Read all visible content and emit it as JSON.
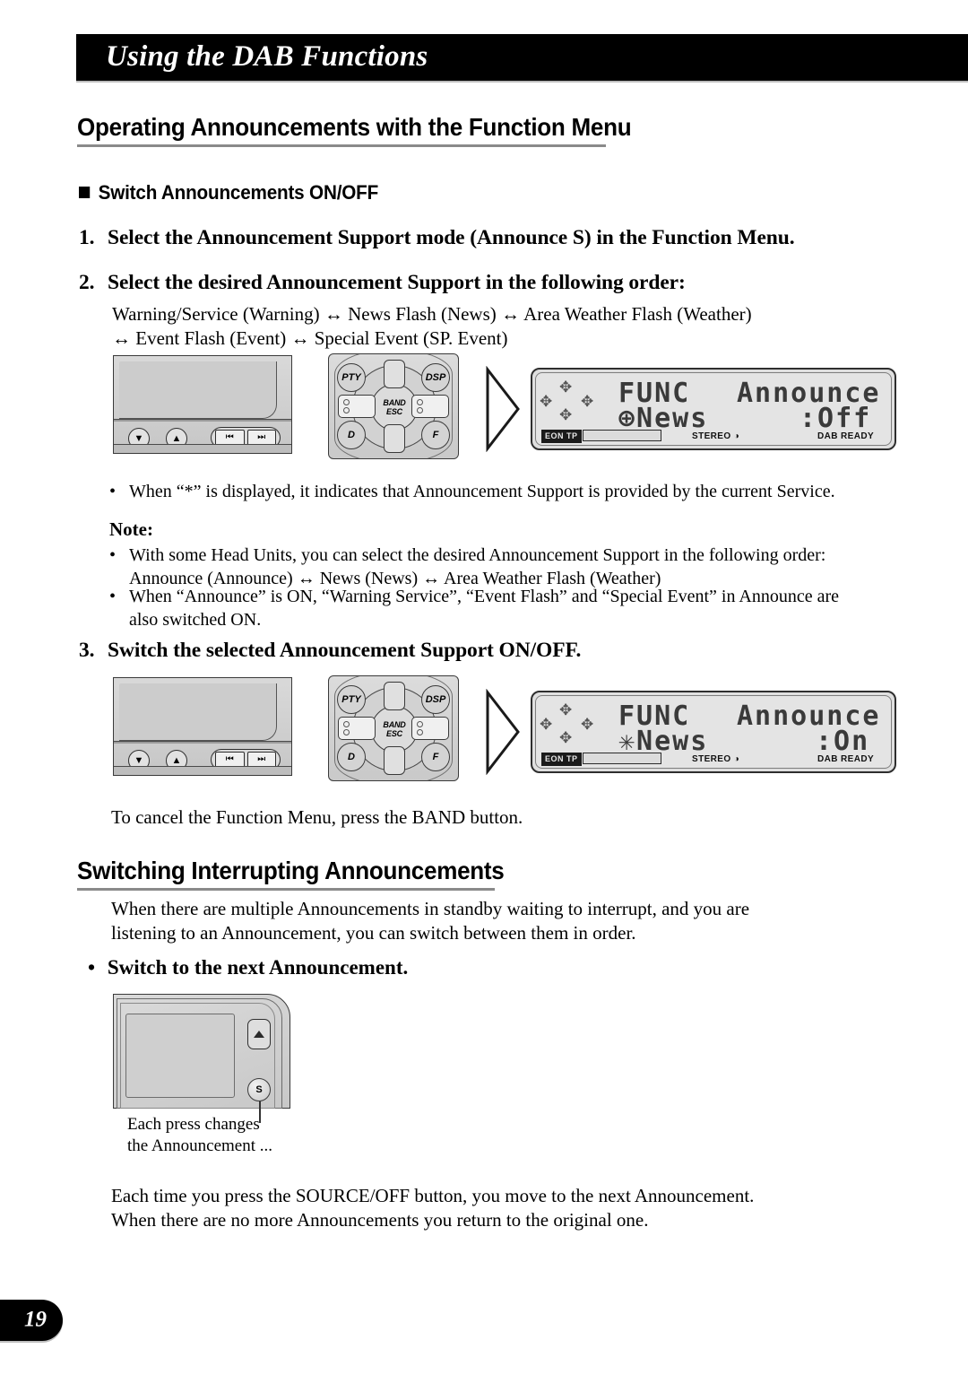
{
  "page": {
    "header_title": "Using the DAB Functions",
    "page_number": "19"
  },
  "section": {
    "heading": "Operating Announcements with the Function Menu",
    "sub_heading": "Switch Announcements ON/OFF"
  },
  "steps": [
    {
      "num": "1.",
      "text": "Select the Announcement Support mode (Announce S) in the Function Menu."
    },
    {
      "num": "2.",
      "text": "Select the desired Announcement Support in the following order:"
    },
    {
      "num": "3.",
      "text": "Switch the selected Announcement Support ON/OFF."
    }
  ],
  "order_lines": {
    "line1": "Warning/Service (Warning) ↔ News Flash (News) ↔ Area Weather Flash (Weather)",
    "line2": "↔ Event Flash (Event) ↔ Special Event (SP. Event)"
  },
  "notes": {
    "asterisk_bullet": "When “*” is displayed, it indicates that Announcement Support is provided by the current Service.",
    "label": "Note:",
    "bullet1_line1": "With some Head Units, you can select the desired Announcement Support in the following order:",
    "bullet1_line2": "Announce (Announce) ↔ News (News) ↔ Area Weather Flash (Weather)",
    "bullet2_line1": "When “Announce” is ON, “Warning Service”, “Event Flash” and “Special Event” in Announce are",
    "bullet2_line2": "also switched ON."
  },
  "cancel_text": "To cancel the Function Menu, press the BAND button.",
  "section2": {
    "heading": "Switching Interrupting Announcements",
    "body_line1": "When there are multiple Announcements in standby waiting to interrupt, and you are",
    "body_line2": "listening to an Announcement, you can switch between them in order.",
    "bullet_heading": "Switch to the next Announcement.",
    "caption_line1": "Each press changes",
    "caption_line2": "the Announcement ...",
    "footer_line1": "Each time you press the SOURCE/OFF button, you move to the next Announcement.",
    "footer_line2": "When there are no more Announcements you return to the original one."
  },
  "head_unit": {
    "down_button": "▼",
    "up_button": "▲",
    "seek_back": "⏮",
    "seek_fwd": "⏭"
  },
  "remote": {
    "pty": "PTY",
    "dsp": "DSP",
    "band": "BAND",
    "esc": "ESC",
    "d": "D",
    "f": "F"
  },
  "lcd_displays": [
    {
      "id": "lcd-off",
      "row1_left": "FUNC",
      "row1_right": "Announce S",
      "row2_left": "⊕News",
      "row2_right": ":Off",
      "eon_tp": "EON  TP",
      "stereo": "STEREO ◑",
      "dab_ready": "DAB READY"
    },
    {
      "id": "lcd-on",
      "row1_left": "FUNC",
      "row1_right": "Announce S",
      "row2_left": "✳News",
      "row2_right": ":On",
      "eon_tp": "EON  TP",
      "stereo": "STEREO ◑",
      "dab_ready": "DAB READY"
    }
  ],
  "corner_unit": {
    "eject_label": "eject",
    "s_label": "S"
  },
  "colors": {
    "header_bar": "#000000",
    "rule": "#8a8a8a",
    "lcd_bg": "#e4e4e4",
    "lcd_text": "#3a3a3a"
  }
}
